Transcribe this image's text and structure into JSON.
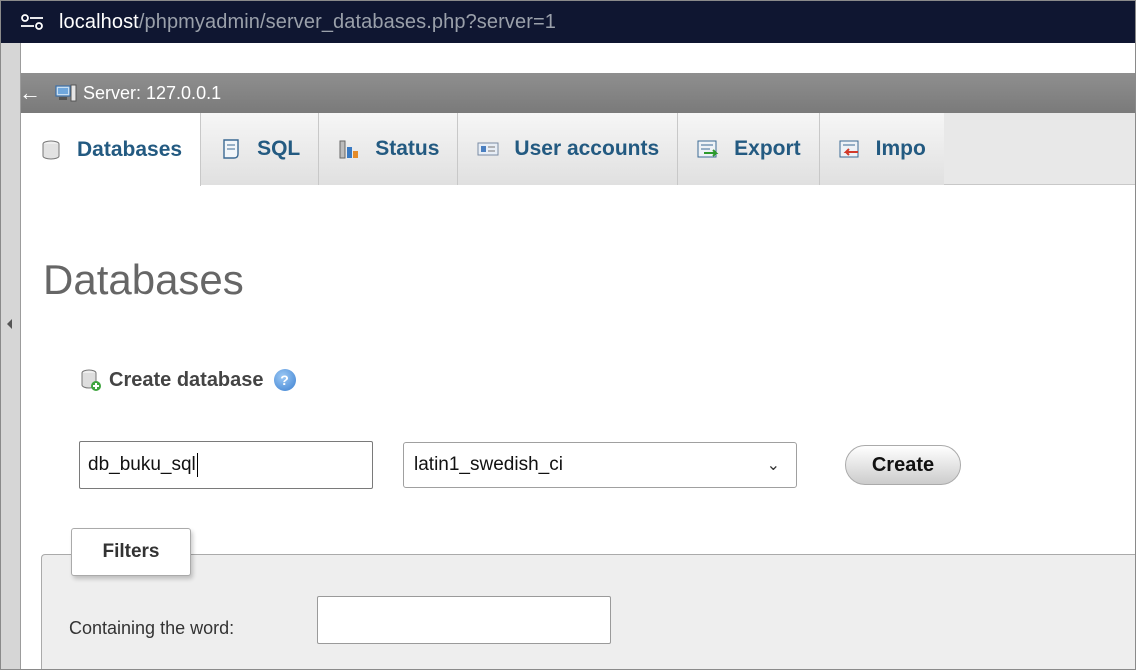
{
  "browser": {
    "url_host": "localhost",
    "url_path": "/phpmyadmin/server_databases.php?server=1"
  },
  "breadcrumb": {
    "back_symbol": "←",
    "server_label": "Server: 127.0.0.1"
  },
  "tabs": [
    {
      "label": "Databases",
      "icon": "database-icon",
      "active": true
    },
    {
      "label": "SQL",
      "icon": "sql-icon",
      "active": false
    },
    {
      "label": "Status",
      "icon": "status-chart-icon",
      "active": false
    },
    {
      "label": "User accounts",
      "icon": "user-accounts-icon",
      "active": false
    },
    {
      "label": "Export",
      "icon": "export-icon",
      "active": false
    },
    {
      "label": "Impo",
      "icon": "import-icon",
      "active": false
    }
  ],
  "main": {
    "title": "Databases",
    "create_heading": "Create database",
    "help_symbol": "?",
    "db_name_value": "db_buku_sql",
    "collation_value": "latin1_swedish_ci",
    "collation_arrow": "⌄",
    "create_button": "Create",
    "filters_legend": "Filters",
    "filter_label": "Containing the word:",
    "filter_value": ""
  },
  "colors": {
    "url_bar": "#0f1631",
    "server_bar": "#858585",
    "tab_text": "#235a81",
    "title": "#666666"
  }
}
